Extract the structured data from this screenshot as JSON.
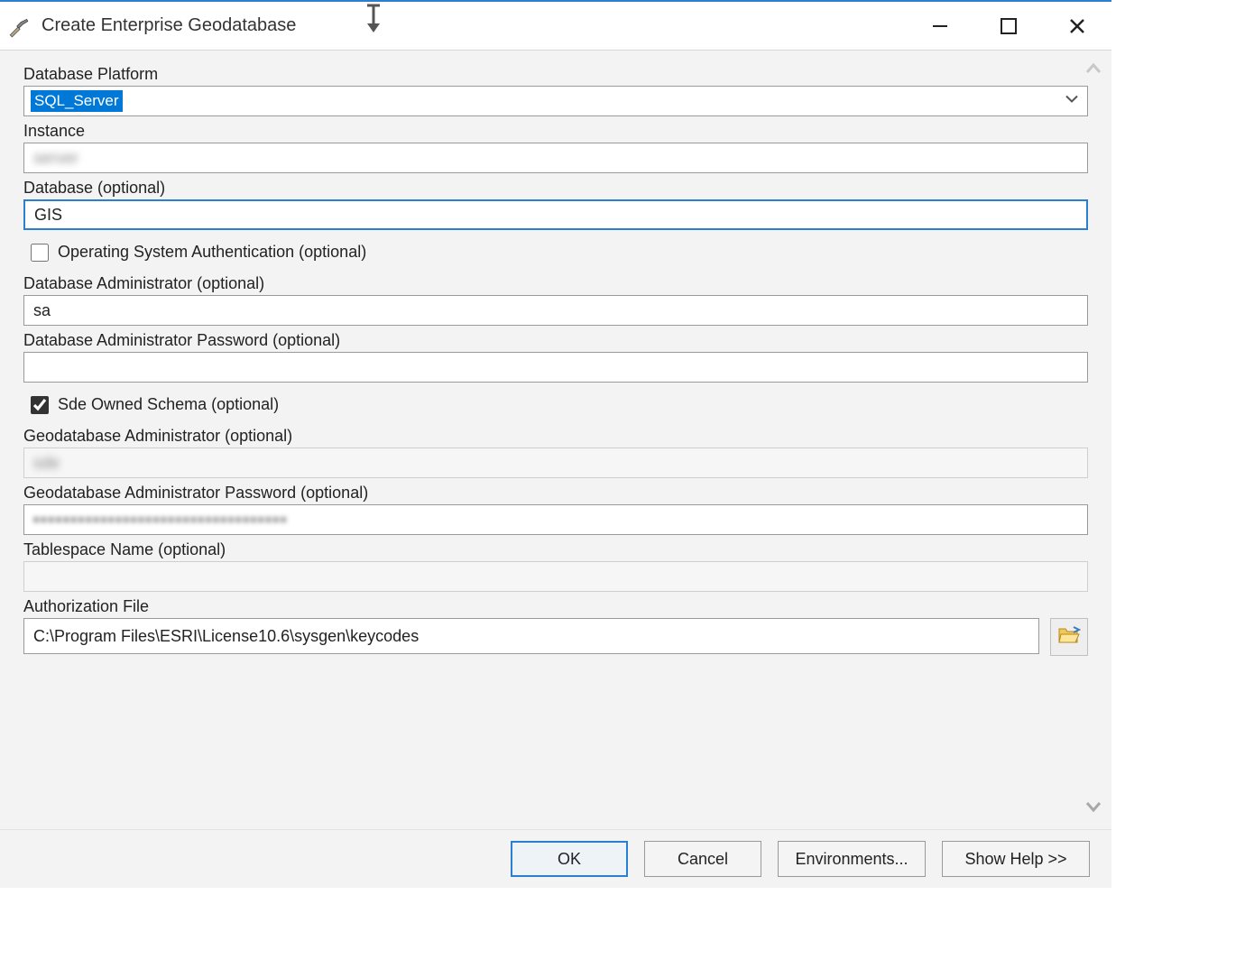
{
  "window": {
    "title": "Create Enterprise Geodatabase"
  },
  "fields": {
    "platform": {
      "label": "Database Platform",
      "value": "SQL_Server"
    },
    "instance": {
      "label": "Instance",
      "value": ""
    },
    "database": {
      "label": "Database (optional)",
      "value": "GIS"
    },
    "os_auth": {
      "label": "Operating System Authentication (optional)",
      "checked": false
    },
    "db_admin": {
      "label": "Database Administrator (optional)",
      "value": "sa"
    },
    "db_admin_pw": {
      "label": "Database Administrator Password (optional)",
      "value": ""
    },
    "sde_owned": {
      "label": "Sde Owned Schema (optional)",
      "checked": true
    },
    "gdb_admin": {
      "label": "Geodatabase Administrator (optional)",
      "value": ""
    },
    "gdb_admin_pw": {
      "label": "Geodatabase Administrator Password (optional)",
      "value": ""
    },
    "tablespace": {
      "label": "Tablespace Name (optional)",
      "value": ""
    },
    "auth_file": {
      "label": "Authorization File",
      "value": "C:\\Program Files\\ESRI\\License10.6\\sysgen\\keycodes"
    }
  },
  "buttons": {
    "ok": "OK",
    "cancel": "Cancel",
    "environments": "Environments...",
    "show_help": "Show Help >>"
  }
}
